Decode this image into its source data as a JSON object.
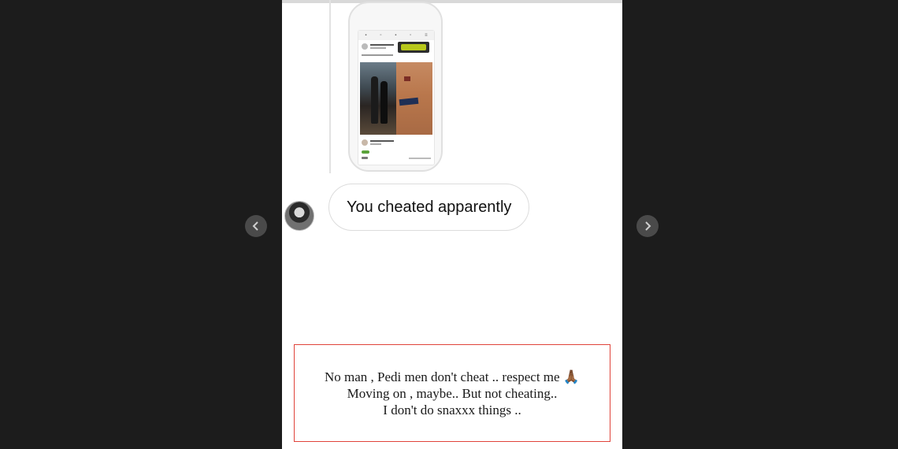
{
  "story": {
    "reply_message": "You cheated apparently",
    "caption": {
      "line1": "No man , Pedi men don't cheat .. respect me 🙏🏾",
      "line2": "Moving on , maybe.. But not cheating..",
      "line3": "I don't do snaxxx things .."
    }
  },
  "navigation": {
    "prev_icon": "chevron-left-icon",
    "next_icon": "chevron-right-icon"
  },
  "colors": {
    "highlight_border": "#e0433a",
    "backdrop": "#1c1c1c"
  }
}
